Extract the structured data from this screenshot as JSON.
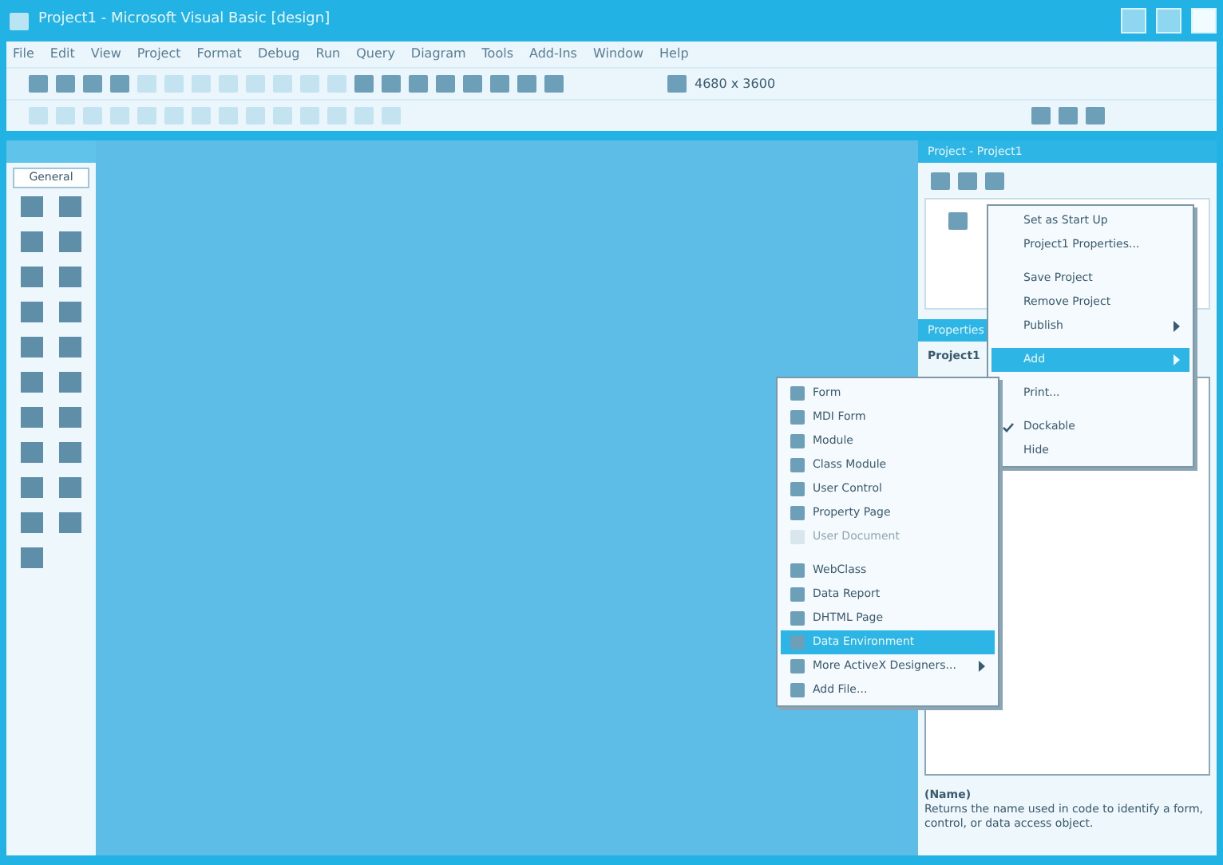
{
  "window": {
    "title": "Project1 - Microsoft Visual Basic [design]"
  },
  "menu_bar": [
    "File",
    "Edit",
    "View",
    "Project",
    "Format",
    "Debug",
    "Run",
    "Query",
    "Diagram",
    "Tools",
    "Add-Ins",
    "Window",
    "Help"
  ],
  "toolbar": {
    "coordinates": "4680 x 3600"
  },
  "toolbox": {
    "tab": "General"
  },
  "project_explorer": {
    "title": "Project - Project1"
  },
  "properties": {
    "title": "Properties",
    "object": "Project1",
    "description_title": "(Name)",
    "description": "Returns the name used in code to identify a form, control, or data access object."
  },
  "context_menu": [
    {
      "kind": "item",
      "label": "Set as Start Up",
      "selected": false,
      "checked": false
    },
    {
      "kind": "item",
      "label": "Project1 Properties...",
      "selected": false,
      "checked": false
    },
    {
      "kind": "separator"
    },
    {
      "kind": "item",
      "label": "Save Project",
      "selected": false,
      "checked": false
    },
    {
      "kind": "item",
      "label": "Remove Project",
      "selected": false,
      "checked": false
    },
    {
      "kind": "submenu",
      "label": "Publish",
      "selected": false,
      "checked": false
    },
    {
      "kind": "separator"
    },
    {
      "kind": "submenu",
      "label": "Add",
      "selected": true,
      "checked": false
    },
    {
      "kind": "separator"
    },
    {
      "kind": "item",
      "label": "Print...",
      "selected": false,
      "checked": false
    },
    {
      "kind": "separator"
    },
    {
      "kind": "item",
      "label": "Dockable",
      "selected": false,
      "checked": true
    },
    {
      "kind": "item",
      "label": "Hide",
      "selected": false,
      "checked": false
    }
  ],
  "add_submenu": [
    {
      "kind": "item",
      "label": "Form",
      "selected": false,
      "disabled": false
    },
    {
      "kind": "item",
      "label": "MDI Form",
      "selected": false,
      "disabled": false
    },
    {
      "kind": "item",
      "label": "Module",
      "selected": false,
      "disabled": false
    },
    {
      "kind": "item",
      "label": "Class Module",
      "selected": false,
      "disabled": false
    },
    {
      "kind": "item",
      "label": "User Control",
      "selected": false,
      "disabled": false
    },
    {
      "kind": "item",
      "label": "Property Page",
      "selected": false,
      "disabled": false
    },
    {
      "kind": "item",
      "label": "User Document",
      "selected": false,
      "disabled": true
    },
    {
      "kind": "separator"
    },
    {
      "kind": "item",
      "label": "WebClass",
      "selected": false,
      "disabled": false
    },
    {
      "kind": "item",
      "label": "Data Report",
      "selected": false,
      "disabled": false
    },
    {
      "kind": "item",
      "label": "DHTML Page",
      "selected": false,
      "disabled": false
    },
    {
      "kind": "item",
      "label": "Data Environment",
      "selected": true,
      "disabled": false
    },
    {
      "kind": "submenu",
      "label": "More ActiveX Designers...",
      "selected": false,
      "disabled": false
    },
    {
      "kind": "item",
      "label": "Add File...",
      "selected": false,
      "disabled": false
    }
  ]
}
